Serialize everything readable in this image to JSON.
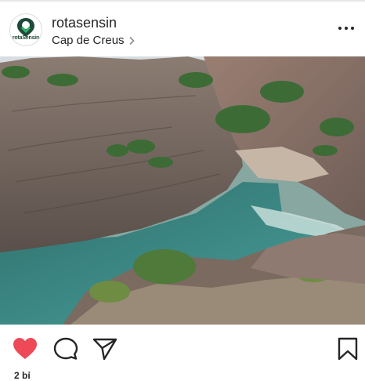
{
  "post": {
    "username": "rotasensin",
    "location": "Cap de Creus",
    "avatar_text": "rotaSensin",
    "photo_alt": "Rocky coastal cove with turquoise water",
    "likes_stub": "2 bỉ"
  },
  "colors": {
    "like_red": "#ed4956",
    "icon_dark": "#262626",
    "brand_green": "#1f4a3a"
  },
  "icons": {
    "like": "heart-icon",
    "comment": "comment-icon",
    "share": "paper-plane-icon",
    "save": "bookmark-icon",
    "more": "more-options-icon",
    "chevron": "chevron-right-icon"
  }
}
